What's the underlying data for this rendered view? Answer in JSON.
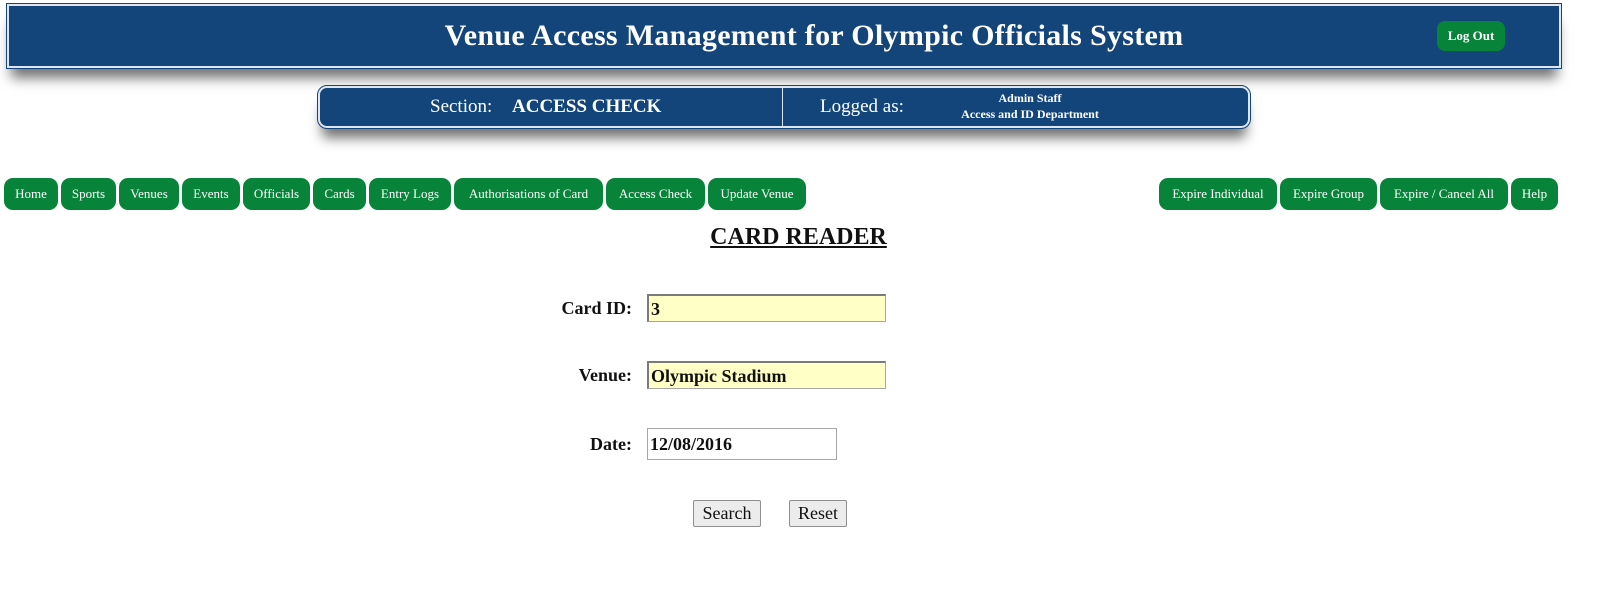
{
  "header": {
    "title": "Venue Access Management for Olympic Officials System",
    "logout_label": "Log Out"
  },
  "section_bar": {
    "section_label": "Section:",
    "section_value": "ACCESS CHECK",
    "logged_label": "Logged as:",
    "user_name": "Admin Staff",
    "user_department": "Access and ID Department"
  },
  "nav": {
    "left": [
      "Home",
      "Sports",
      "Venues",
      "Events",
      "Officials",
      "Cards",
      "Entry Logs",
      "Authorisations of Card",
      "Access Check",
      "Update Venue"
    ],
    "right": [
      "Expire Individual",
      "Expire Group",
      "Expire / Cancel All",
      "Help"
    ]
  },
  "form": {
    "heading": "CARD READER",
    "card_id_label": "Card ID:",
    "card_id_value": "3",
    "venue_label": "Venue:",
    "venue_value": "Olympic Stadium",
    "date_label": "Date:",
    "date_value": "12/08/2016",
    "search_label": "Search",
    "reset_label": "Reset"
  },
  "colors": {
    "header_blue": "#13457a",
    "nav_green": "#07843a",
    "field_yellow": "#ffffc6"
  }
}
